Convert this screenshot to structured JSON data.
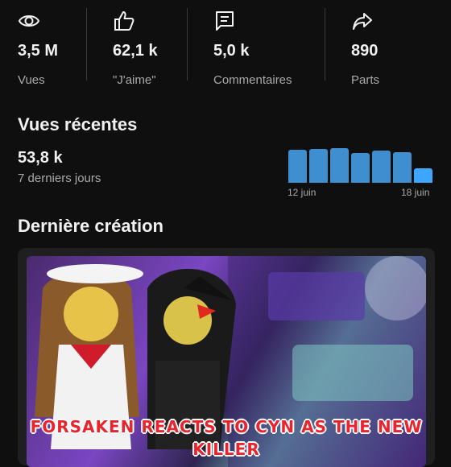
{
  "stats": [
    {
      "icon": "eye-icon",
      "value": "3,5 M",
      "label": "Vues"
    },
    {
      "icon": "thumbs-up-icon",
      "value": "62,1 k",
      "label": "\"J'aime\""
    },
    {
      "icon": "comment-icon",
      "value": "5,0 k",
      "label": "Commentaires"
    },
    {
      "icon": "share-icon",
      "value": "890",
      "label": "Parts"
    }
  ],
  "recent_views": {
    "title": "Vues récentes",
    "value": "53,8 k",
    "subtitle": "7 derniers jours",
    "start_date": "12 juin",
    "end_date": "18 juin"
  },
  "chart_data": {
    "type": "bar",
    "categories": [
      "12 juin",
      "",
      "",
      "",
      "",
      "",
      "18 juin"
    ],
    "values": [
      0.95,
      0.97,
      0.99,
      0.86,
      0.93,
      0.88,
      0.42
    ],
    "highlight_last": true,
    "colors": {
      "bar": "#3e8ed0",
      "today": "#3ea6ff"
    }
  },
  "latest_creation": {
    "title": "Dernière création",
    "video_title": "FORSAKEN REACTS TO CYN AS THE NEW KILLER"
  }
}
